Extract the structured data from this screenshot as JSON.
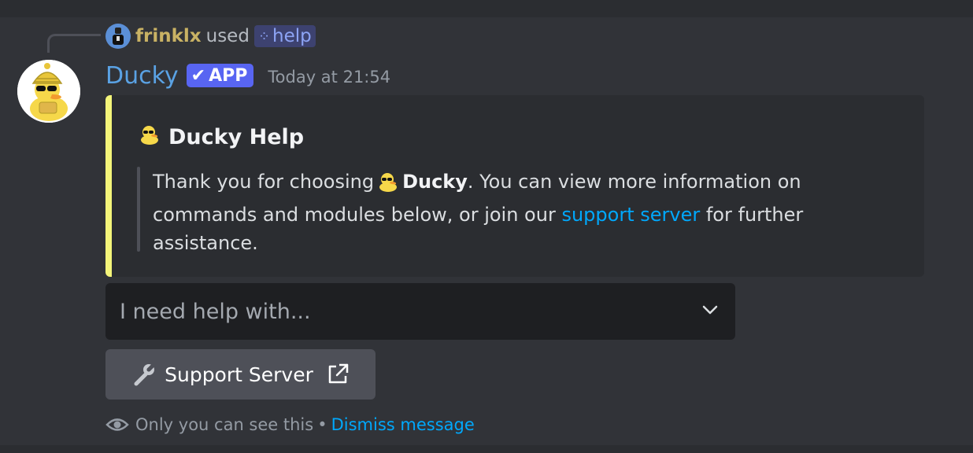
{
  "reply": {
    "user_name": "frinklx",
    "used_text": "used",
    "command_name": "help",
    "command_icon": "slash-command-icon"
  },
  "message": {
    "author_name": "Ducky",
    "app_badge": "APP",
    "timestamp": "Today at 21:54"
  },
  "embed": {
    "accent_color": "#f4f57a",
    "title": "Ducky Help",
    "description_before": "Thank you for choosing",
    "description_bold": "Ducky",
    "description_middle": ". You can view more information on commands and modules below, or join our",
    "description_link": "support server",
    "description_after": "for further assistance."
  },
  "select_menu": {
    "placeholder": "I need help with..."
  },
  "support_button": {
    "label": "Support Server"
  },
  "ephemeral_note": {
    "text": "Only you can see this",
    "separator": "•",
    "dismiss_label": "Dismiss message"
  },
  "colors": {
    "background": "#313338",
    "embed_background": "#2b2d31",
    "author_name": "#5aa2e4",
    "app_badge": "#5865f2",
    "link": "#00a8fc"
  }
}
